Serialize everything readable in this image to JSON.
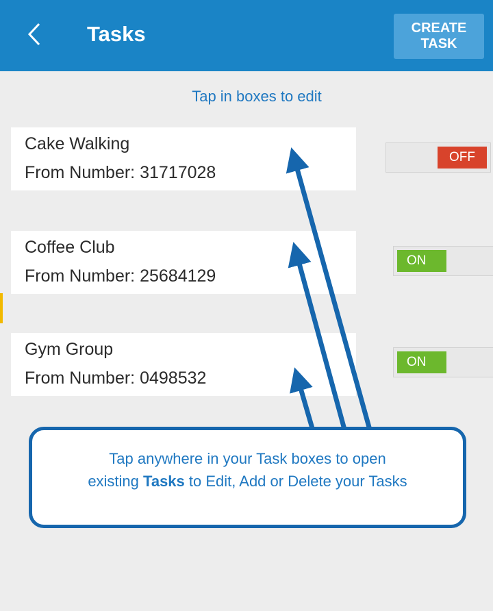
{
  "header": {
    "back_icon": "chevron-left-icon",
    "title": "Tasks",
    "create_button_label": "CREATE\nTASK",
    "background_color": "#1a84c6"
  },
  "hint": "Tap in boxes to edit",
  "tasks": [
    {
      "name": "Cake Walking",
      "number": "From Number: 31717028",
      "toggle": "OFF"
    },
    {
      "name": "Coffee Club",
      "number": "From Number: 25684129",
      "toggle": "ON"
    },
    {
      "name": "Gym Group",
      "number": "From Number: 0498532",
      "toggle": "ON"
    }
  ],
  "callout": {
    "line1": "Tap anywhere in your Task boxes to open",
    "line2_before": "existing ",
    "line2_bold": "Tasks",
    "line2_after": " to Edit, Add or Delete your Tasks"
  },
  "colors": {
    "toggle_off": "#d8432b",
    "toggle_on": "#6cb82d",
    "callout_border": "#1666ad",
    "callout_text": "#1f78c1"
  }
}
